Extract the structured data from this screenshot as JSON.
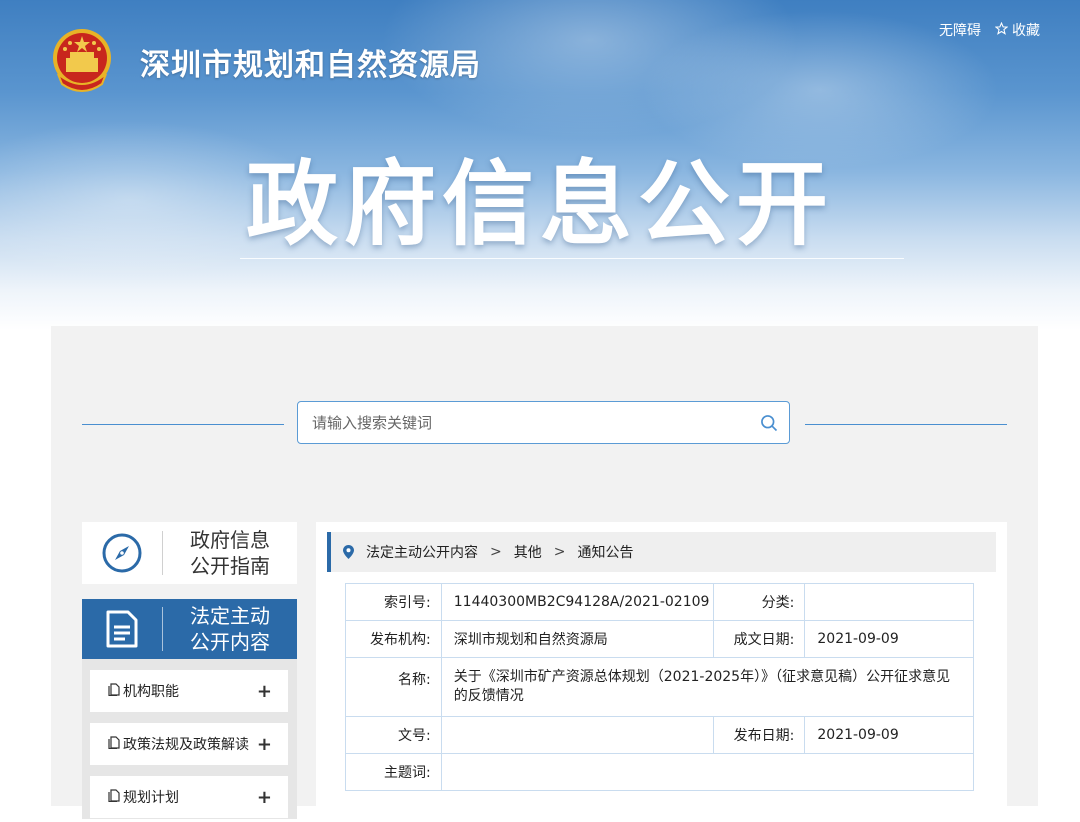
{
  "header": {
    "site_title": "深圳市规划和自然资源局",
    "accessibility": "无障碍",
    "favorite": "收藏",
    "banner_title": "政府信息公开"
  },
  "search": {
    "placeholder": "请输入搜索关键词"
  },
  "sidebar": {
    "guide": {
      "line1": "政府信息",
      "line2": "公开指南"
    },
    "active": {
      "line1": "法定主动",
      "line2": "公开内容"
    },
    "items": [
      {
        "label": "机构职能",
        "toggle": "+"
      },
      {
        "label": "政策法规及政策解读",
        "toggle": "+"
      },
      {
        "label": "规划计划",
        "toggle": "+"
      }
    ]
  },
  "breadcrumb": [
    "法定主动公开内容",
    "其他",
    "通知公告"
  ],
  "meta": {
    "index_label": "索引号:",
    "index_value": "11440300MB2C94128A/2021-02109",
    "category_label": "分类:",
    "category_value": "",
    "publisher_label": "发布机构:",
    "publisher_value": "深圳市规划和自然资源局",
    "created_label": "成文日期:",
    "created_value": "2021-09-09",
    "name_label": "名称:",
    "name_value": "关于《深圳市矿产资源总体规划（2021-2025年）》（征求意见稿）公开征求意见的反馈情况",
    "docno_label": "文号:",
    "docno_value": "",
    "published_label": "发布日期:",
    "published_value": "2021-09-09",
    "subject_label": "主题词:",
    "subject_value": ""
  },
  "colors": {
    "accent": "#2b6aa8",
    "banner_blue": "#4a86c6",
    "panel_bg": "#f2f2f2"
  }
}
